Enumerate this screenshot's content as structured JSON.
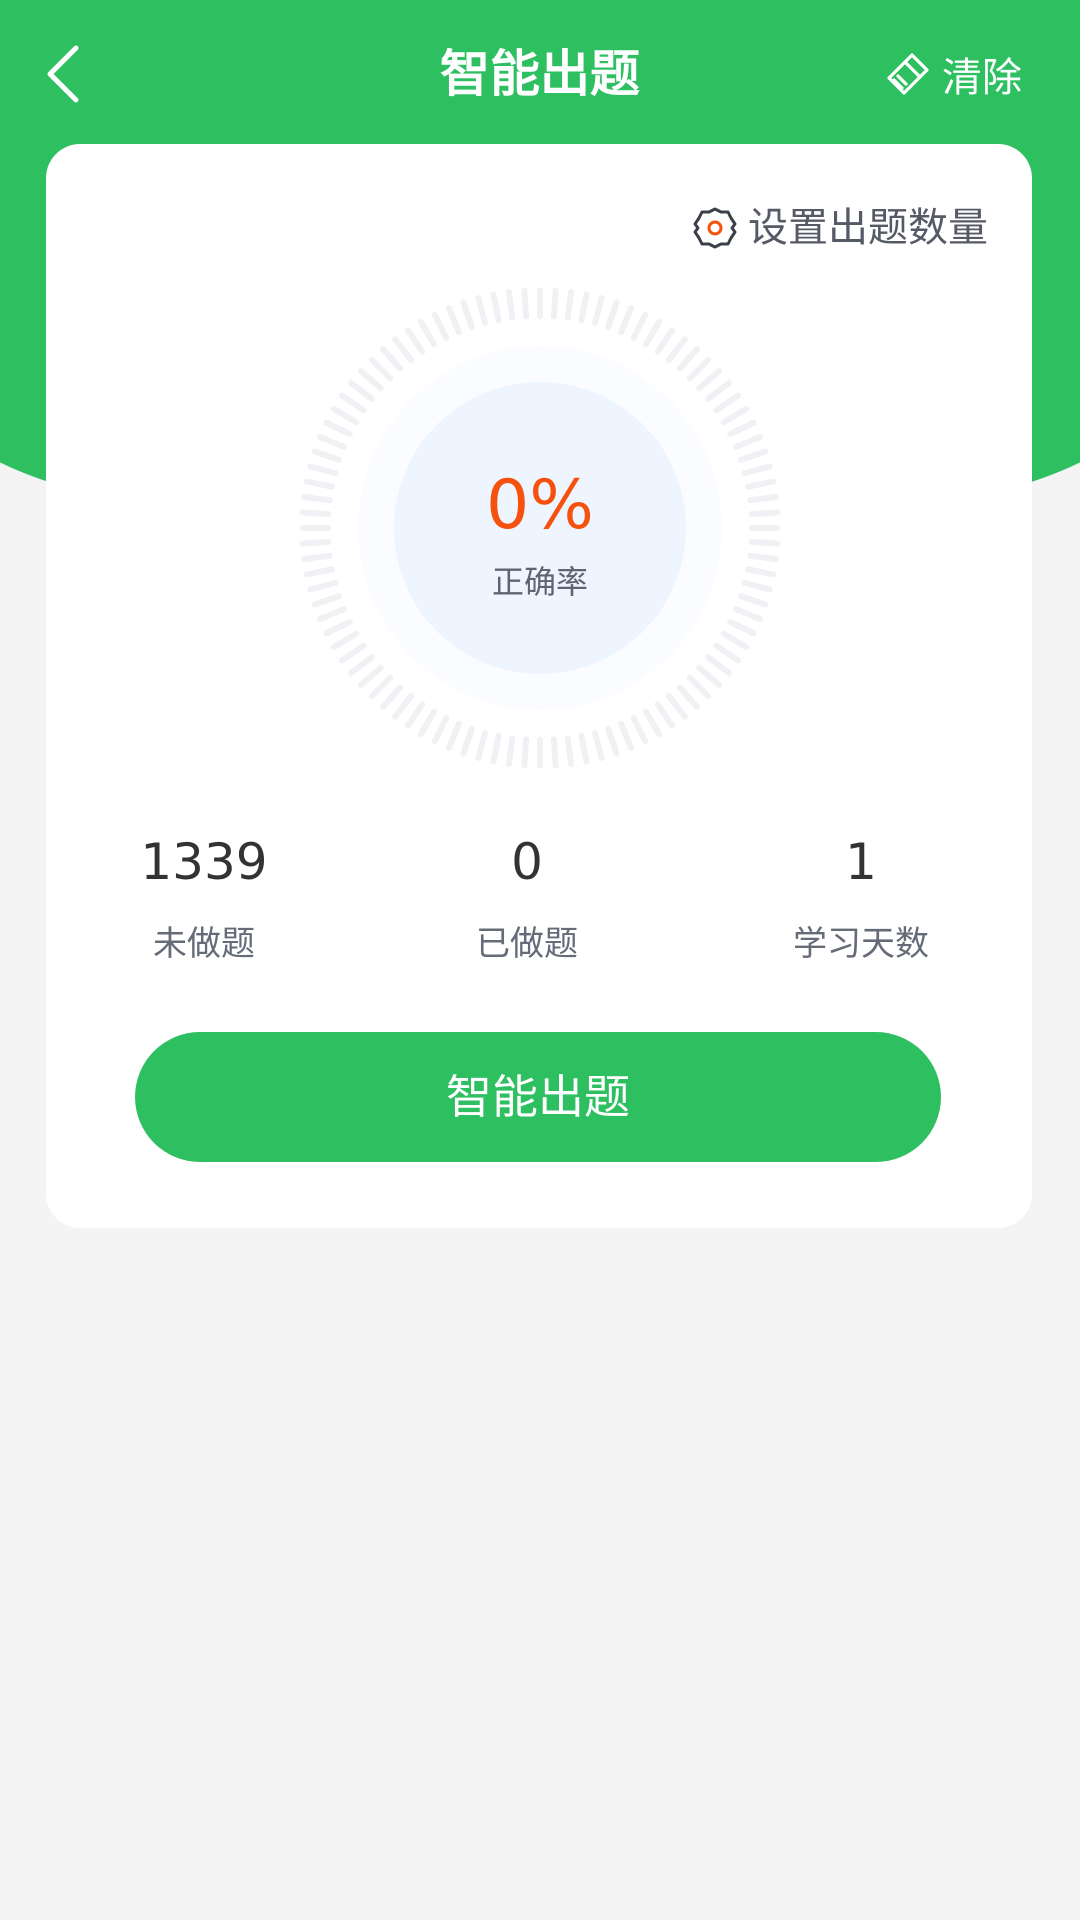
{
  "header": {
    "title": "智能出题",
    "back_icon": "chevron-left-icon",
    "clear_label": "清除",
    "clear_icon": "eraser-icon",
    "background_color": "#2ebf61"
  },
  "card": {
    "settings_label": "设置出题数量",
    "settings_icon": "gear-icon",
    "accuracy": {
      "value_text": "0%",
      "label": "正确率",
      "value_color": "#f5520f"
    },
    "stats": [
      {
        "value": "1339",
        "label": "未做题"
      },
      {
        "value": "0",
        "label": "已做题"
      },
      {
        "value": "1",
        "label": "学习天数"
      }
    ],
    "start_button_label": "智能出题"
  }
}
